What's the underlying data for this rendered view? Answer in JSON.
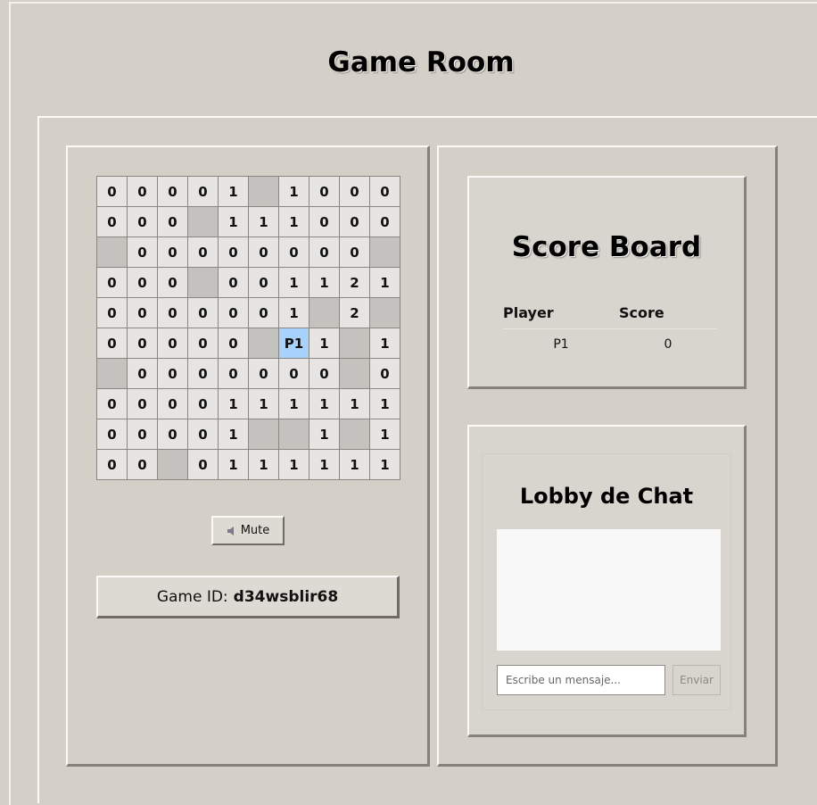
{
  "title": "Game Room",
  "board": {
    "rows": [
      [
        "0",
        "0",
        "0",
        "0",
        "1",
        "",
        "1",
        "0",
        "0",
        "0"
      ],
      [
        "0",
        "0",
        "0",
        "",
        "1",
        "1",
        "1",
        "0",
        "0",
        "0"
      ],
      [
        "",
        "0",
        "0",
        "0",
        "0",
        "0",
        "0",
        "0",
        "0",
        ""
      ],
      [
        "0",
        "0",
        "0",
        "",
        "0",
        "0",
        "1",
        "1",
        "2",
        "1"
      ],
      [
        "0",
        "0",
        "0",
        "0",
        "0",
        "0",
        "1",
        "",
        "2",
        ""
      ],
      [
        "0",
        "0",
        "0",
        "0",
        "0",
        "",
        "P1",
        "1",
        "",
        "1"
      ],
      [
        "",
        "0",
        "0",
        "0",
        "0",
        "0",
        "0",
        "0",
        "",
        "0"
      ],
      [
        "0",
        "0",
        "0",
        "0",
        "1",
        "1",
        "1",
        "1",
        "1",
        "1"
      ],
      [
        "0",
        "0",
        "0",
        "0",
        "1",
        "",
        "",
        "1",
        "",
        "1"
      ],
      [
        "0",
        "0",
        "",
        "0",
        "1",
        "1",
        "1",
        "1",
        "1",
        "1"
      ]
    ],
    "player_marker": "P1"
  },
  "mute": {
    "label": "Mute",
    "icon": "speaker-icon"
  },
  "game_id": {
    "label": "Game ID:",
    "value": "d34wsblir68"
  },
  "scoreboard": {
    "title": "Score Board",
    "headers": [
      "Player",
      "Score"
    ],
    "rows": [
      {
        "player": "P1",
        "score": "0"
      }
    ]
  },
  "chat": {
    "title": "Lobby de Chat",
    "input_placeholder": "Escribe un mensaje...",
    "send_label": "Enviar"
  },
  "colors": {
    "background": "#d4d0c8",
    "cell_revealed": "#e6e5e3",
    "cell_hidden": "#c4c2bf",
    "cell_player": "#a8d2fc",
    "chat_box": "#f8f8f8"
  }
}
